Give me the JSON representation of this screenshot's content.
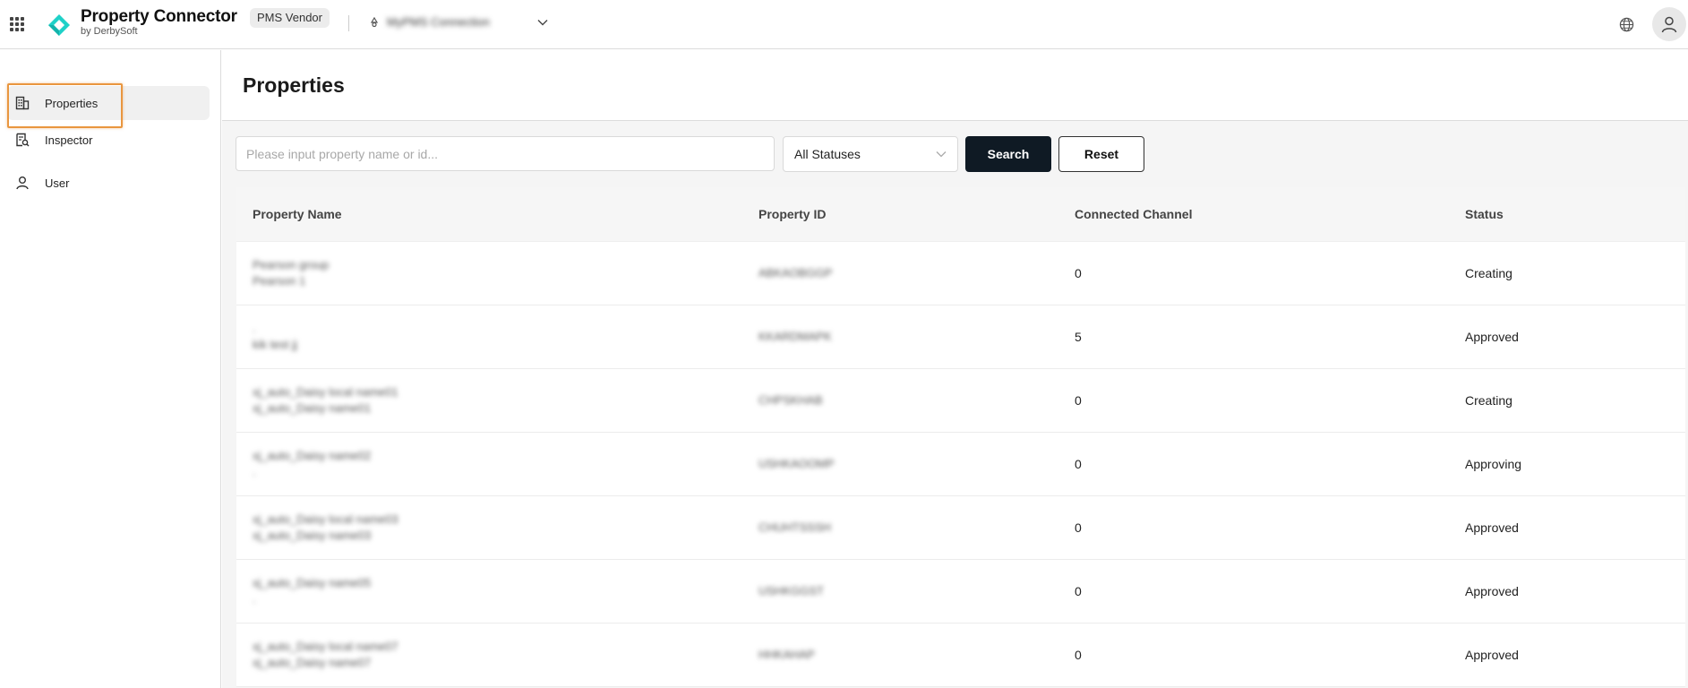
{
  "header": {
    "brand_name": "Property Connector",
    "brand_by": "by DerbySoft",
    "vendor_badge": "PMS Vendor",
    "org_name": "MyPMS Connection",
    "accent_color": "#1fd1c8"
  },
  "sidebar": {
    "items": [
      {
        "label": "Properties",
        "icon": "building-icon",
        "active": true
      },
      {
        "label": "Inspector",
        "icon": "document-search-icon",
        "active": false
      },
      {
        "label": "User",
        "icon": "user-icon",
        "active": false
      }
    ]
  },
  "main": {
    "title": "Properties",
    "search": {
      "placeholder": "Please input property name or id...",
      "value": ""
    },
    "status_filter": {
      "value": "All Statuses"
    },
    "search_button": "Search",
    "reset_button": "Reset",
    "table": {
      "columns": [
        "Property Name",
        "Property ID",
        "Connected Channel",
        "Status"
      ],
      "rows": [
        {
          "name_line1": "Pearson group",
          "name_line2": "Pearson 1",
          "id": "ABKAOBGGP",
          "channels": "0",
          "status": "Creating"
        },
        {
          "name_line1": ".",
          "name_line2": "kik test jj",
          "id": "KKARDMAPK",
          "channels": "5",
          "status": "Approved"
        },
        {
          "name_line1": "xj_auto_Daisy local name01",
          "name_line2": "xj_auto_Daisy name01",
          "id": "CHPSKHAB",
          "channels": "0",
          "status": "Creating"
        },
        {
          "name_line1": "xj_auto_Daisy name02",
          "name_line2": ".",
          "id": "USHKAOOMP",
          "channels": "0",
          "status": "Approving"
        },
        {
          "name_line1": "xj_auto_Daisy local name03",
          "name_line2": "xj_auto_Daisy name03",
          "id": "CHUHTSSSH",
          "channels": "0",
          "status": "Approved"
        },
        {
          "name_line1": "xj_auto_Daisy name05",
          "name_line2": ".",
          "id": "USHKGGST",
          "channels": "0",
          "status": "Approved"
        },
        {
          "name_line1": "xj_auto_Daisy local name07",
          "name_line2": "xj_auto_Daisy name07",
          "id": "HHKAHAP",
          "channels": "0",
          "status": "Approved"
        }
      ]
    }
  }
}
